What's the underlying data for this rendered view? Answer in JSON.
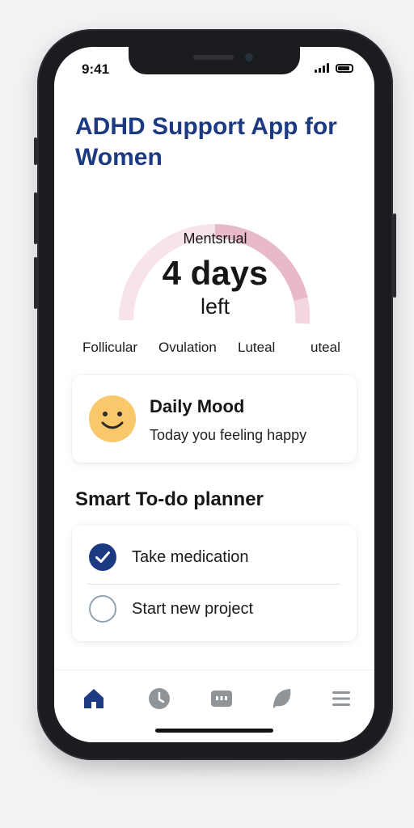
{
  "status_bar": {
    "time": "9:41"
  },
  "app": {
    "title": "ADHD Support App for Women"
  },
  "cycle": {
    "phase": "Mentsrual",
    "days": "4 days",
    "left": "left",
    "phases": [
      "Follicular",
      "Ovulation",
      "Luteal",
      "uteal"
    ],
    "colors": {
      "track": "#f8e3ea",
      "progress": "#e8b8cb",
      "segment": "#f3d6df"
    }
  },
  "mood": {
    "title": "Daily Mood",
    "text": "Today you feeling happy",
    "icon": "smiley-face-icon",
    "face_color": "#f8c86a"
  },
  "planner": {
    "title": "Smart To-do planner",
    "tasks": [
      {
        "label": "Take medication",
        "done": true
      },
      {
        "label": "Start new project",
        "done": false
      }
    ]
  },
  "tabbar": {
    "items": [
      {
        "icon": "home-icon",
        "active": true
      },
      {
        "icon": "clock-icon",
        "active": false
      },
      {
        "icon": "chat-icon",
        "active": false
      },
      {
        "icon": "leaf-icon",
        "active": false
      },
      {
        "icon": "menu-icon",
        "active": false
      }
    ],
    "active_color": "#1c3a82",
    "inactive_color": "#8f9499"
  }
}
